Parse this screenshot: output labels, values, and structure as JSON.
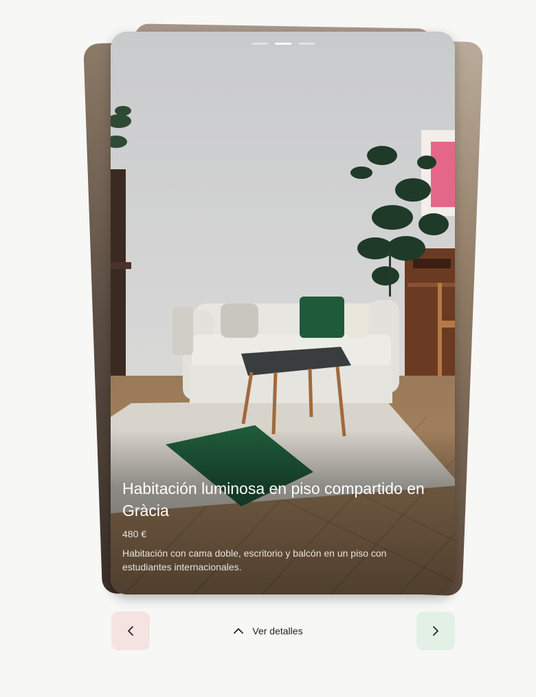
{
  "card": {
    "title": "Habitación luminosa en piso compartido en Gràcia",
    "price": "480 €",
    "description": "Habitación con cama doble, escritorio y balcón en un piso con estudiantes internacionales.",
    "photo_count": 3,
    "active_photo_index": 1
  },
  "controls": {
    "details_label": "Ver detalles",
    "details_icon": "chevron-up-icon",
    "prev_icon": "chevron-left-icon",
    "next_icon": "chevron-right-icon"
  },
  "colors": {
    "prev_button_bg": "#f5e3e2",
    "next_button_bg": "#e3f0e6",
    "page_bg": "#f7f7f6"
  }
}
